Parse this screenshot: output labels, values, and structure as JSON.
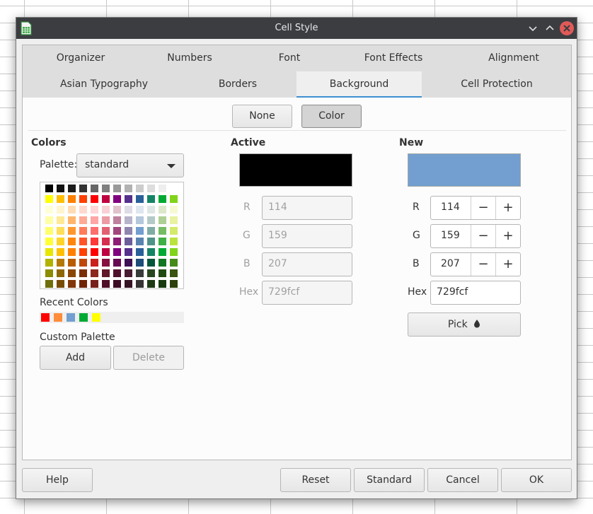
{
  "window": {
    "title": "Cell Style"
  },
  "tabs_row1": [
    "Organizer",
    "Numbers",
    "Font",
    "Font Effects",
    "Alignment"
  ],
  "tabs_row2": [
    "Asian Typography",
    "Borders",
    "Background",
    "Cell Protection"
  ],
  "active_tab": "Background",
  "fill_type": {
    "none_label": "None",
    "color_label": "Color",
    "selected": "Color"
  },
  "colors_section": {
    "heading": "Colors",
    "palette_label": "Palette:",
    "palette_value": "standard",
    "recent_label": "Recent Colors",
    "custom_palette_label": "Custom Palette",
    "add_label": "Add",
    "delete_label": "Delete"
  },
  "palette_colors": [
    [
      "#000000",
      "#111111",
      "#1c1c1c",
      "#333333",
      "#666666",
      "#808080",
      "#999999",
      "#b2b2b2",
      "#cccccc",
      "#dddddd",
      "#eeeeee",
      "#ffffff"
    ],
    [
      "#ffff00",
      "#ffbf00",
      "#ff8000",
      "#ff4000",
      "#ff0000",
      "#bf0041",
      "#800080",
      "#55308d",
      "#2a6099",
      "#158466",
      "#00a933",
      "#81d41a"
    ],
    [
      "#ffffd7",
      "#fff5ce",
      "#ffdbb6",
      "#ffd8ce",
      "#ffd7d7",
      "#f7d1d5",
      "#e0c2cd",
      "#dedce6",
      "#dee6ef",
      "#dee7e5",
      "#dde8cb",
      "#f6f9d4"
    ],
    [
      "#ffffa6",
      "#ffe994",
      "#ffb66c",
      "#ffaa95",
      "#ffa6a6",
      "#ec9ba4",
      "#bf819e",
      "#b7b3ca",
      "#b4c7dc",
      "#b3cac7",
      "#afd095",
      "#e8f2a1"
    ],
    [
      "#ffff6d",
      "#ffde59",
      "#ff972f",
      "#ff7b59",
      "#ff6d6d",
      "#e16173",
      "#a1467e",
      "#8e86ae",
      "#729fcf",
      "#81aca6",
      "#77bc65",
      "#d4ea6b"
    ],
    [
      "#ffff38",
      "#ffd428",
      "#ff860d",
      "#ff5429",
      "#ff3838",
      "#d62e4e",
      "#8d1d75",
      "#6b5e9b",
      "#5983b0",
      "#50938a",
      "#3faf46",
      "#bbe33d"
    ],
    [
      "#e6e600",
      "#ffbf00",
      "#ff8000",
      "#ff4000",
      "#ff0000",
      "#bf0041",
      "#800080",
      "#55308d",
      "#2a6099",
      "#158466",
      "#00a933",
      "#81d41a"
    ],
    [
      "#b2b200",
      "#b47804",
      "#b85c00",
      "#be480a",
      "#c9211e",
      "#861141",
      "#650953",
      "#3d0f55",
      "#1e4d7b",
      "#05563b",
      "#127622",
      "#468a1a"
    ],
    [
      "#8c8c00",
      "#8e6704",
      "#8b4705",
      "#7b2d05",
      "#8d281e",
      "#611729",
      "#4e102d",
      "#481d32",
      "#383d3c",
      "#28471f",
      "#224b12",
      "#395511"
    ],
    [
      "#706e0c",
      "#784b04",
      "#813709",
      "#6f2405",
      "#78201b",
      "#4f0f26",
      "#3c0b24",
      "#351224",
      "#353333",
      "#1d3a15",
      "#173a0e",
      "#2b400b"
    ]
  ],
  "recent_colors": [
    "#ff0000",
    "#ff8c3a",
    "#729fcf",
    "#00a933",
    "#ffff00"
  ],
  "active": {
    "heading": "Active",
    "color": "#000000",
    "r_label": "R",
    "r_value": "114",
    "g_label": "G",
    "g_value": "159",
    "b_label": "B",
    "b_value": "207",
    "hex_label": "Hex",
    "hex_value": "729fcf"
  },
  "new": {
    "heading": "New",
    "color": "#729fcf",
    "r_label": "R",
    "r_value": "114",
    "g_label": "G",
    "g_value": "159",
    "b_label": "B",
    "b_value": "207",
    "hex_label": "Hex",
    "hex_value": "729fcf",
    "minus": "−",
    "plus": "+",
    "pick_label": "Pick"
  },
  "footer": {
    "help": "Help",
    "reset": "Reset",
    "standard": "Standard",
    "cancel": "Cancel",
    "ok": "OK"
  },
  "accent_color": "#3d8fd1"
}
